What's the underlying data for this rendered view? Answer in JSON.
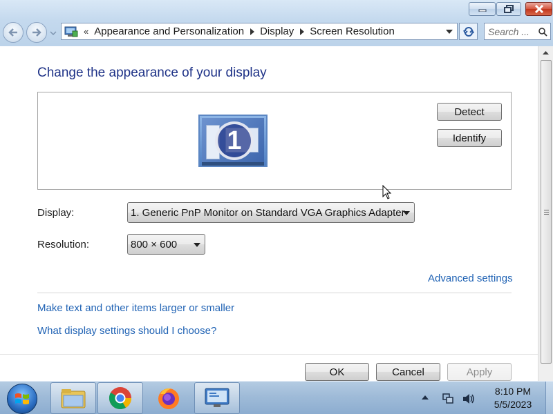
{
  "window": {
    "minimize_icon": "minimize-icon",
    "maximize_icon": "restore-icon",
    "close_icon": "close-icon"
  },
  "addressbar": {
    "overflow": "«",
    "crumbs": [
      "Appearance and Personalization",
      "Display",
      "Screen Resolution"
    ]
  },
  "search": {
    "placeholder": "Search ..."
  },
  "main": {
    "title": "Change the appearance of your display",
    "monitor_number": "1",
    "detect_label": "Detect",
    "identify_label": "Identify",
    "display_label": "Display:",
    "display_value": "1. Generic PnP Monitor on Standard VGA Graphics Adapter",
    "resolution_label": "Resolution:",
    "resolution_value": "800 × 600",
    "advanced_link": "Advanced settings",
    "text_size_link": "Make text and other items larger or smaller",
    "help_link": "What display settings should I choose?",
    "ok_label": "OK",
    "cancel_label": "Cancel",
    "apply_label": "Apply"
  },
  "taskbar": {
    "time": "8:10 PM",
    "date": "5/5/2023"
  },
  "colors": {
    "title_blue": "#1e3287",
    "link_blue": "#1f62b4",
    "close_red": "#c2351c"
  }
}
